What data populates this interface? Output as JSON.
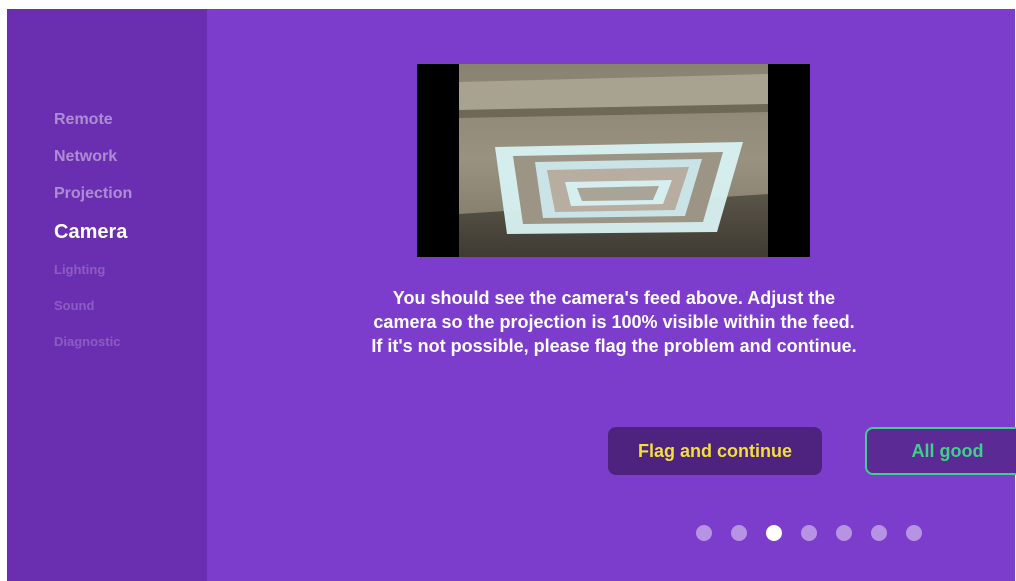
{
  "sidebar": {
    "items": [
      {
        "label": "Remote",
        "state": "done"
      },
      {
        "label": "Network",
        "state": "done"
      },
      {
        "label": "Projection",
        "state": "done"
      },
      {
        "label": "Camera",
        "state": "active"
      },
      {
        "label": "Lighting",
        "state": "upcoming"
      },
      {
        "label": "Sound",
        "state": "upcoming"
      },
      {
        "label": "Diagnostic",
        "state": "upcoming"
      }
    ]
  },
  "main": {
    "message": "You should see the camera's feed above. Adjust the camera so the projection is 100% visible within the feed. If it's not possible, please flag the problem and continue.",
    "flag_button_label": "Flag and continue",
    "ok_button_label": "All good"
  },
  "pager": {
    "total": 7,
    "current": 3
  },
  "colors": {
    "background": "#7c3dcc",
    "sidebar": "#6a2fb0",
    "flag_text": "#f3df3a",
    "ok_accent": "#3fd08c"
  }
}
